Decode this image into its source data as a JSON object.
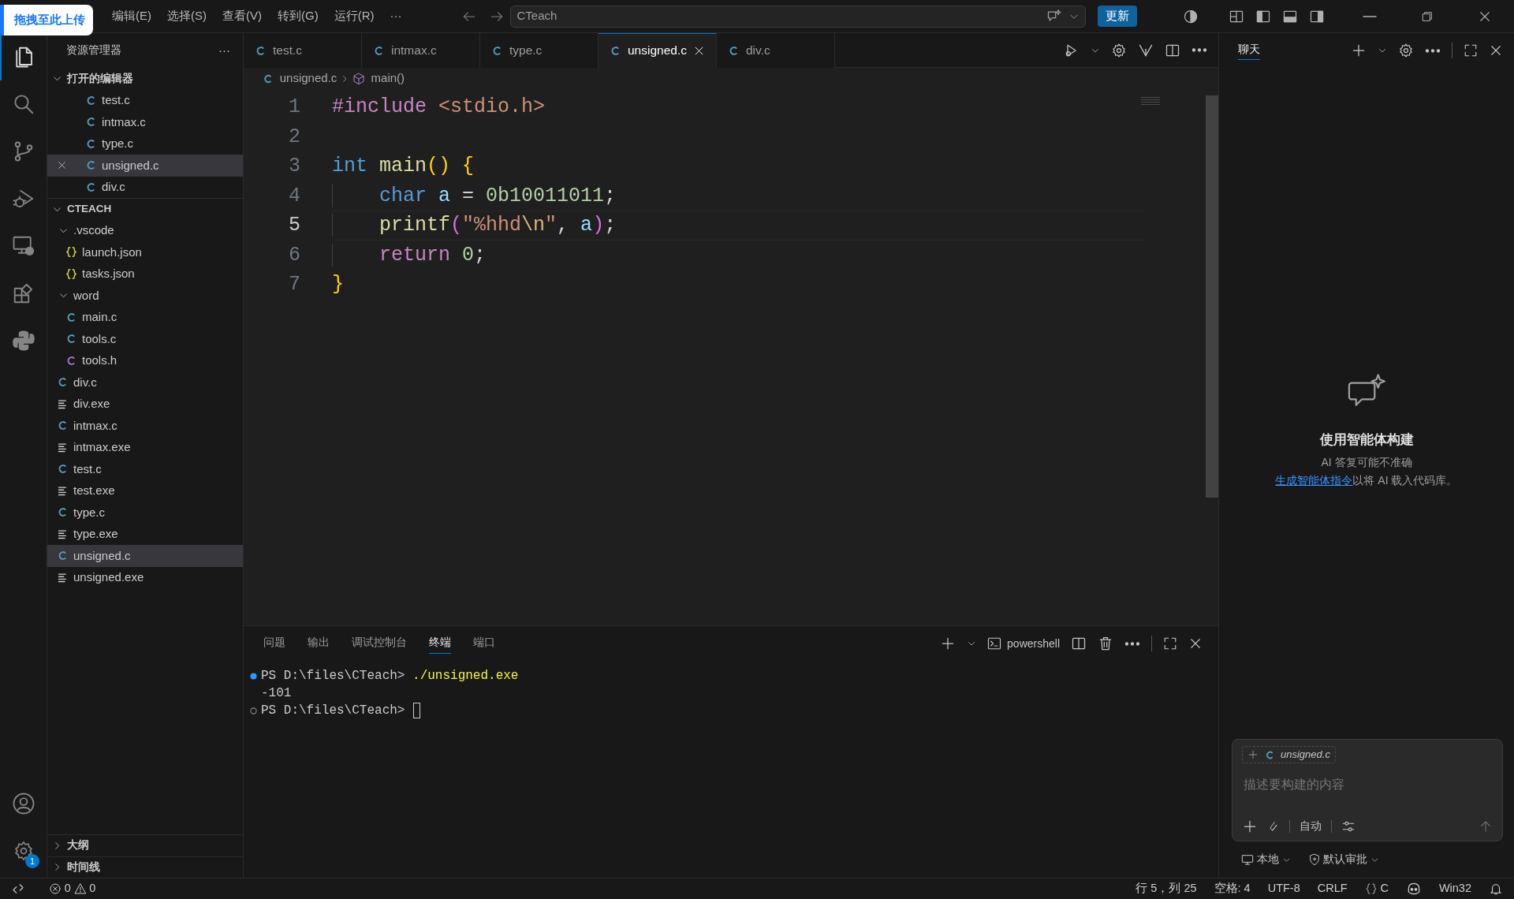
{
  "upload_badge": "拖拽至此上传",
  "menu": [
    "编辑(E)",
    "选择(S)",
    "查看(V)",
    "转到(G)",
    "运行(R)",
    "···"
  ],
  "command_center": {
    "text": "CTeach"
  },
  "update_button": "更新",
  "activity_bar": [
    {
      "kind": "files",
      "selected": true
    },
    {
      "kind": "search",
      "selected": false
    },
    {
      "kind": "branch",
      "selected": false
    },
    {
      "kind": "debug",
      "selected": false
    },
    {
      "kind": "remote",
      "selected": false
    },
    {
      "kind": "extensions",
      "selected": false
    },
    {
      "kind": "python",
      "selected": false
    }
  ],
  "settings_badge": "1",
  "sidebar": {
    "title": "资源管理器",
    "more": "···",
    "open_editors": {
      "title": "打开的编辑器",
      "expanded": true,
      "items": [
        {
          "name": "test.c",
          "kind": "c",
          "selected": false
        },
        {
          "name": "intmax.c",
          "kind": "c",
          "selected": false
        },
        {
          "name": "type.c",
          "kind": "c",
          "selected": false
        },
        {
          "name": "unsigned.c",
          "kind": "c",
          "selected": true
        },
        {
          "name": "div.c",
          "kind": "c",
          "selected": false
        }
      ]
    },
    "folder": {
      "title": "CTEACH",
      "expanded": true,
      "children": [
        {
          "name": ".vscode",
          "kind": "folder",
          "expanded": true,
          "selected": false,
          "children": [
            {
              "name": "launch.json",
              "kind": "json",
              "selected": false
            },
            {
              "name": "tasks.json",
              "kind": "json",
              "selected": false
            }
          ]
        },
        {
          "name": "word",
          "kind": "folder",
          "expanded": true,
          "selected": false,
          "children": [
            {
              "name": "main.c",
              "kind": "c",
              "selected": false
            },
            {
              "name": "tools.c",
              "kind": "c",
              "selected": false
            },
            {
              "name": "tools.h",
              "kind": "h",
              "selected": false
            }
          ]
        },
        {
          "name": "div.c",
          "kind": "c",
          "selected": false
        },
        {
          "name": "div.exe",
          "kind": "exe",
          "selected": false
        },
        {
          "name": "intmax.c",
          "kind": "c",
          "selected": false
        },
        {
          "name": "intmax.exe",
          "kind": "exe",
          "selected": false
        },
        {
          "name": "test.c",
          "kind": "c",
          "selected": false
        },
        {
          "name": "test.exe",
          "kind": "exe",
          "selected": false
        },
        {
          "name": "type.c",
          "kind": "c",
          "selected": false
        },
        {
          "name": "type.exe",
          "kind": "exe",
          "selected": false
        },
        {
          "name": "unsigned.c",
          "kind": "c",
          "selected": true
        },
        {
          "name": "unsigned.exe",
          "kind": "exe",
          "selected": false
        }
      ]
    },
    "bottom_sections": [
      {
        "title": "大纲",
        "expanded": false
      },
      {
        "title": "时间线",
        "expanded": false
      }
    ]
  },
  "tabs": [
    {
      "label": "test.c",
      "selected": false
    },
    {
      "label": "intmax.c",
      "selected": false
    },
    {
      "label": "type.c",
      "selected": false
    },
    {
      "label": "unsigned.c",
      "selected": true
    },
    {
      "label": "div.c",
      "selected": false
    }
  ],
  "breadcrumb": [
    {
      "label": "unsigned.c",
      "kind": "file"
    },
    {
      "label": "main()",
      "kind": "symbol"
    }
  ],
  "editor": {
    "lines": [
      {
        "number": "1",
        "current": false,
        "indent": false,
        "tokens": [
          {
            "text": "#include",
            "kind": "directive"
          },
          {
            "text": " <stdio.h>",
            "kind": "header"
          }
        ]
      },
      {
        "number": "2",
        "current": false,
        "indent": false
      },
      {
        "number": "3",
        "current": false,
        "indent": false,
        "tokens": [
          {
            "text": "int",
            "kind": "type"
          },
          {
            "text": " main",
            "kind": "func"
          },
          {
            "text": "()",
            "kind": "bracket1"
          },
          {
            "text": " {",
            "kind": "bracket1"
          }
        ]
      },
      {
        "number": "4",
        "current": false,
        "indent": true,
        "tokens": [
          {
            "text": "char",
            "kind": "type"
          },
          {
            "text": " a",
            "kind": "var"
          },
          {
            "text": " = ",
            "kind": "plain"
          },
          {
            "text": "0b10011011",
            "kind": "num"
          },
          {
            "text": ";",
            "kind": "plain"
          }
        ]
      },
      {
        "number": "5",
        "current": true,
        "indent": true,
        "tokens": [
          {
            "text": "printf",
            "kind": "func"
          },
          {
            "text": "(",
            "kind": "bracket2"
          },
          {
            "text": "\"%hhd",
            "kind": "str"
          },
          {
            "text": "\\n",
            "kind": "escape"
          },
          {
            "text": "\"",
            "kind": "str"
          },
          {
            "text": ", ",
            "kind": "plain"
          },
          {
            "text": "a",
            "kind": "var"
          },
          {
            "text": ")",
            "kind": "bracket2"
          },
          {
            "text": ";",
            "kind": "plain"
          }
        ]
      },
      {
        "number": "6",
        "current": false,
        "indent": true,
        "tokens": [
          {
            "text": "return",
            "kind": "keyword"
          },
          {
            "text": " 0",
            "kind": "num"
          },
          {
            "text": ";",
            "kind": "plain"
          }
        ]
      },
      {
        "number": "7",
        "current": false,
        "indent": false,
        "tokens": [
          {
            "text": "}",
            "kind": "bracket1"
          }
        ]
      }
    ]
  },
  "panel": {
    "tabs": [
      {
        "label": "问题",
        "selected": false
      },
      {
        "label": "输出",
        "selected": false
      },
      {
        "label": "调试控制台",
        "selected": false
      },
      {
        "label": "终端",
        "selected": true
      },
      {
        "label": "端口",
        "selected": false
      }
    ],
    "shell": "powershell",
    "terminal": [
      {
        "kind": "command",
        "succeeded": true,
        "prompt": "PS D:\\files\\CTeach> ",
        "command": "./unsigned.exe"
      },
      {
        "kind": "output",
        "text": "-101"
      },
      {
        "kind": "command",
        "succeeded": false,
        "prompt": "PS D:\\files\\CTeach> ",
        "cursor": true
      }
    ]
  },
  "chat": {
    "title": "聊天",
    "heading": "使用智能体构建",
    "note": "AI 答复可能不准确",
    "hint_link": "生成智能体指令",
    "hint_text": "以将 AI 载入代码库。",
    "context_file": "unsigned.c",
    "placeholder": "描述要构建的内容",
    "mode": "自动",
    "location": "本地",
    "approval": "默认审批"
  },
  "status_bar": {
    "errors": "0",
    "warnings": "0",
    "position": "行 5，列 25",
    "indent": "空格: 4",
    "encoding": "UTF-8",
    "eol": "CRLF",
    "language": "C",
    "platform": "Win32"
  }
}
